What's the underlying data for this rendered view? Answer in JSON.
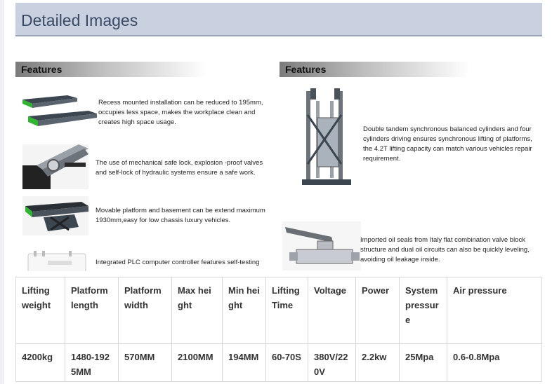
{
  "section": {
    "title": "Detailed Images"
  },
  "features": {
    "left_title": "Features",
    "right_title": "Features",
    "left_items": [
      {
        "text": "Recess mounted installation can be reduced to 195mm, occupies less space, makes the workplace clean and creates high space usage.",
        "icon": "platform-lift-icon"
      },
      {
        "text": "The use of mechanical safe lock, explosion -proof valves and self-lock of hydraulic systems ensure a safe work.",
        "icon": "safe-lock-icon"
      },
      {
        "text": "Movable platform and basement can be extend maximum 1930mm,easy for low chassis luxury vehicles.",
        "icon": "movable-platform-icon"
      },
      {
        "text": "Integrated PLC computer controller features self-testing",
        "icon": "plc-controller-icon"
      }
    ],
    "right_items": [
      {
        "text": "Double tandem synchronous balanced cylinders and four cylinders driving ensures synchronous lifting of platforms, the 4.2T lifting capacity can match various vehicles repair requirement.",
        "icon": "cylinder-frame-icon"
      },
      {
        "text": "Imported oil seals from Italy flat combination valve block structure and dual oil circuits can also be quickly leveling, avoiding oil leakage inside.",
        "icon": "valve-icon"
      }
    ]
  },
  "spec_table": {
    "headers": [
      "Lifting weight",
      "Platform length",
      "Platform width",
      "Max height",
      "Min height",
      "Lifting Time",
      "Voltage",
      "Power",
      "System pressure",
      "Air pressure"
    ],
    "values": [
      "4200kg",
      "1480-1925MM",
      "570MM",
      "2100MM",
      "194MM",
      "60-70S",
      "380V/220V",
      "2.2kw",
      "25Mpa",
      "0.6-0.8Mpa"
    ]
  },
  "colors": {
    "header_bg": "#c9d0df",
    "accent_green": "#2fb52f",
    "platform_dark": "#3c4650"
  }
}
